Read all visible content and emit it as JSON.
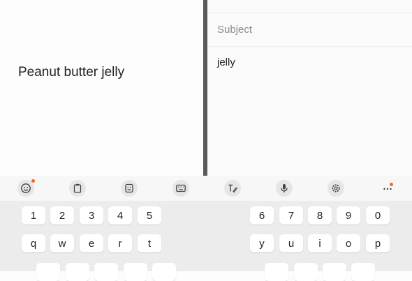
{
  "left_pane": {
    "text": "Peanut butter jelly"
  },
  "compose": {
    "subject_placeholder": "Subject",
    "body_text": "jelly"
  },
  "keyboard": {
    "toolbar_icons": [
      "emoji-icon",
      "clipboard-icon",
      "sticker-icon",
      "keyboard-icon",
      "handwriting-icon",
      "microphone-icon",
      "gear-icon",
      "more-icon"
    ],
    "left_number_row": [
      "1",
      "2",
      "3",
      "4",
      "5"
    ],
    "right_number_row": [
      "6",
      "7",
      "8",
      "9",
      "0"
    ],
    "left_letter_row": [
      "q",
      "w",
      "e",
      "r",
      "t"
    ],
    "right_letter_row": [
      "y",
      "u",
      "i",
      "o",
      "p"
    ],
    "notification_dot_color": "#f26b1d"
  }
}
